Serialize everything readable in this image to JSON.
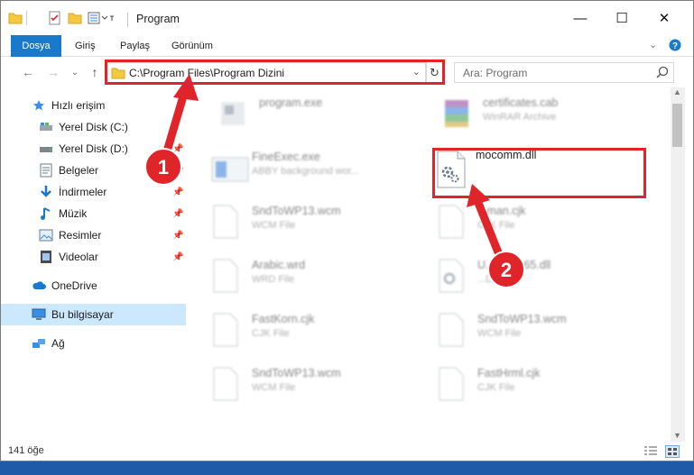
{
  "window": {
    "title": "Program",
    "controls": {
      "minimize": "—",
      "maximize": "☐",
      "close": "✕"
    }
  },
  "ribbon": {
    "tabs": [
      {
        "label": "Dosya",
        "active": true
      },
      {
        "label": "Giriş"
      },
      {
        "label": "Paylaş"
      },
      {
        "label": "Görünüm"
      }
    ]
  },
  "address": {
    "path": "C:\\Program Files\\Program Dizini",
    "search_placeholder": "Ara: Program"
  },
  "nav": {
    "items": [
      {
        "label": "Hızlı erişim",
        "icon": "star-icon",
        "pinned": false
      },
      {
        "label": "Yerel Disk (C:)",
        "icon": "drive-icon",
        "pinned": false
      },
      {
        "label": "Yerel Disk (D:)",
        "icon": "drive-icon",
        "pinned": true
      },
      {
        "label": "Belgeler",
        "icon": "documents-icon",
        "pinned": true
      },
      {
        "label": "İndirmeler",
        "icon": "download-icon",
        "pinned": true
      },
      {
        "label": "Müzik",
        "icon": "music-icon",
        "pinned": true
      },
      {
        "label": "Resimler",
        "icon": "pictures-icon",
        "pinned": true
      },
      {
        "label": "Videolar",
        "icon": "video-icon",
        "pinned": true
      },
      {
        "label": "OneDrive",
        "icon": "cloud-icon",
        "pinned": false
      },
      {
        "label": "Bu bilgisayar",
        "icon": "computer-icon",
        "pinned": false,
        "selected": true
      },
      {
        "label": "Ağ",
        "icon": "network-icon",
        "pinned": false
      }
    ]
  },
  "files": [
    {
      "name": "program.exe",
      "type": "",
      "icon": "exe-icon",
      "blurred": true
    },
    {
      "name": "certificates.cab",
      "type": "WinRAR Archive",
      "icon": "archive-icon",
      "blurred": true
    },
    {
      "name": "FineExec.exe",
      "type": "ABBY background wor...",
      "icon": "app-window-icon",
      "blurred": true
    },
    {
      "name": "mocomm.dll",
      "type": "",
      "icon": "dll-gear-icon",
      "blurred": false
    },
    {
      "name": "SndToWP13.wcm",
      "type": "WCM File",
      "icon": "blank-file-icon",
      "blurred": true
    },
    {
      "name": "...man.cjk",
      "type": "CJK File",
      "icon": "blank-file-icon",
      "blurred": true
    },
    {
      "name": "Arabic.wrd",
      "type": "WRD File",
      "icon": "blank-file-icon",
      "blurred": true
    },
    {
      "name": "U...Client65.dll",
      "type": "...DLL",
      "icon": "dll-gear-icon",
      "blurred": true
    },
    {
      "name": "FastKorn.cjk",
      "type": "CJK File",
      "icon": "blank-file-icon",
      "blurred": true
    },
    {
      "name": "SndToWP13.wcm",
      "type": "WCM File",
      "icon": "blank-file-icon",
      "blurred": true
    },
    {
      "name": "SndToWP13.wcm",
      "type": "WCM File",
      "icon": "blank-file-icon",
      "blurred": true
    },
    {
      "name": "FastHrml.cjk",
      "type": "CJK File",
      "icon": "blank-file-icon",
      "blurred": true
    }
  ],
  "status": {
    "item_count": "141 öğe"
  },
  "annotations": [
    {
      "number": "1"
    },
    {
      "number": "2"
    }
  ],
  "colors": {
    "accent": "#1979ca",
    "highlight": "#e0252a",
    "selected": "#cce8ff"
  }
}
